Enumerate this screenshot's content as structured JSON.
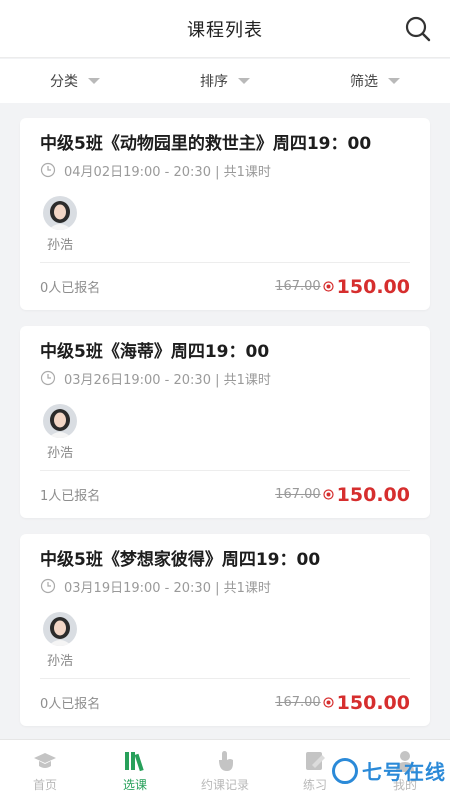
{
  "header": {
    "title": "课程列表",
    "search_icon": "search-icon"
  },
  "filters": [
    {
      "label": "分类"
    },
    {
      "label": "排序"
    },
    {
      "label": "筛选"
    }
  ],
  "courses": [
    {
      "title": "中级5班《动物园里的救世主》周四19：00",
      "time": "04月02日19:00 - 20:30 | 共1课时",
      "teacher": "孙浩",
      "enrolled": "0人已报名",
      "original_price": "167.00",
      "price": "150.00"
    },
    {
      "title": "中级5班《海蒂》周四19：00",
      "time": "03月26日19:00 - 20:30 | 共1课时",
      "teacher": "孙浩",
      "enrolled": "1人已报名",
      "original_price": "167.00",
      "price": "150.00"
    },
    {
      "title": "中级5班《梦想家彼得》周四19：00",
      "time": "03月19日19:00 - 20:30 | 共1课时",
      "teacher": "孙浩",
      "enrolled": "0人已报名",
      "original_price": "167.00",
      "price": "150.00"
    }
  ],
  "tabs": [
    {
      "label": "首页",
      "icon": "graduation-cap-icon",
      "active": false
    },
    {
      "label": "选课",
      "icon": "books-icon",
      "active": true
    },
    {
      "label": "约课记录",
      "icon": "tap-hand-icon",
      "active": false
    },
    {
      "label": "练习",
      "icon": "edit-icon",
      "active": false
    },
    {
      "label": "我的",
      "icon": "person-icon",
      "active": false
    }
  ],
  "watermark": {
    "text": "七号在线"
  },
  "colors": {
    "accent": "#27a05a",
    "price": "#d62e2e",
    "muted": "#9a9a9a",
    "background": "#f2f3f5"
  }
}
